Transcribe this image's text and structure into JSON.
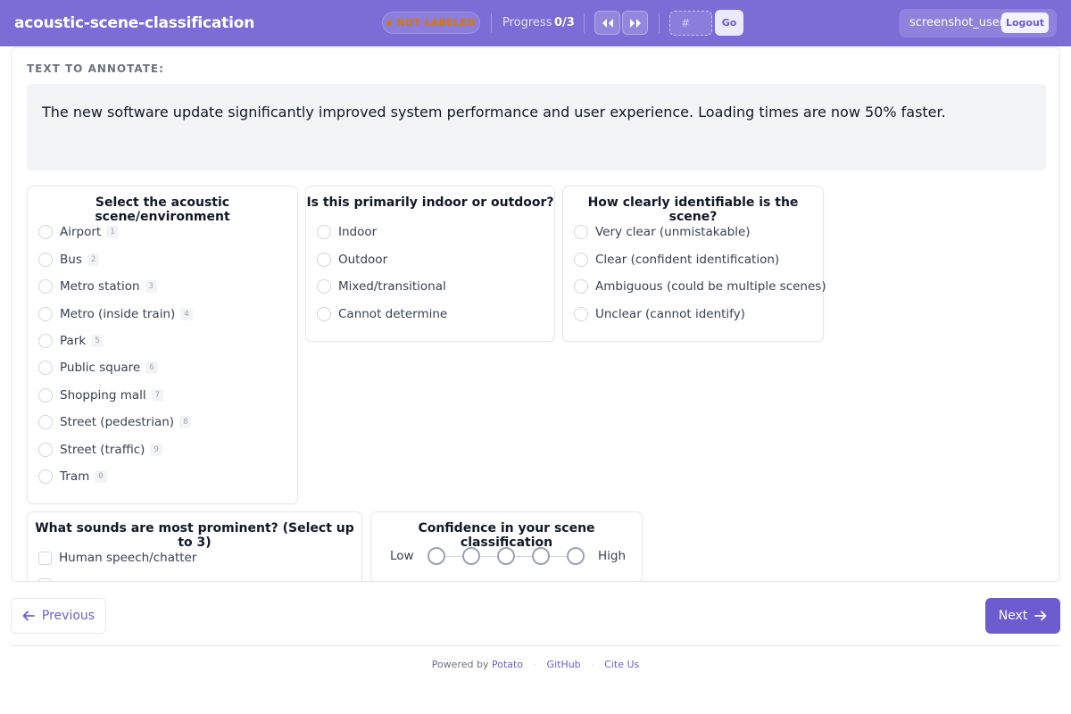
{
  "header": {
    "title": "acoustic-scene-classification",
    "status": "NOT LABELED",
    "progress_label": "Progress",
    "progress_value": "0/3",
    "jump_placeholder": "#",
    "go_label": "Go",
    "username": "screenshot_user",
    "logout_label": "Logout",
    "accent_color": "#7c6cd6",
    "status_color": "#d97706"
  },
  "main": {
    "section_label": "TEXT TO ANNOTATE:",
    "text": "The new software update significantly improved system performance and user experience. Loading times are now 50% faster."
  },
  "questions": {
    "scene": {
      "title": "Select the acoustic scene/environment",
      "options": [
        {
          "label": "Airport",
          "key": "1"
        },
        {
          "label": "Bus",
          "key": "2"
        },
        {
          "label": "Metro station",
          "key": "3"
        },
        {
          "label": "Metro (inside train)",
          "key": "4"
        },
        {
          "label": "Park",
          "key": "5"
        },
        {
          "label": "Public square",
          "key": "6"
        },
        {
          "label": "Shopping mall",
          "key": "7"
        },
        {
          "label": "Street (pedestrian)",
          "key": "8"
        },
        {
          "label": "Street (traffic)",
          "key": "9"
        },
        {
          "label": "Tram",
          "key": "0"
        }
      ]
    },
    "indoor": {
      "title": "Is this primarily indoor or outdoor?",
      "options": [
        "Indoor",
        "Outdoor",
        "Mixed/transitional",
        "Cannot determine"
      ]
    },
    "clarity": {
      "title": "How clearly identifiable is the scene?",
      "options": [
        "Very clear (unmistakable)",
        "Clear (confident identification)",
        "Ambiguous (could be multiple scenes)",
        "Unclear (cannot identify)"
      ]
    },
    "sounds": {
      "title": "What sounds are most prominent? (Select up to 3)",
      "options": [
        "Human speech/chatter"
      ]
    },
    "confidence": {
      "title": "Confidence in your scene classification",
      "low_label": "Low",
      "high_label": "High",
      "scale_points": 5
    }
  },
  "footer": {
    "prev_label": "Previous",
    "next_label": "Next",
    "powered_by": "Powered by",
    "potato": "Potato",
    "github": "GitHub",
    "cite": "Cite Us"
  },
  "icons": {
    "prev_nav": "double-chevron-left-icon",
    "next_nav": "double-chevron-right-icon",
    "prev_arrow": "arrow-left-icon",
    "next_arrow": "arrow-right-icon"
  }
}
